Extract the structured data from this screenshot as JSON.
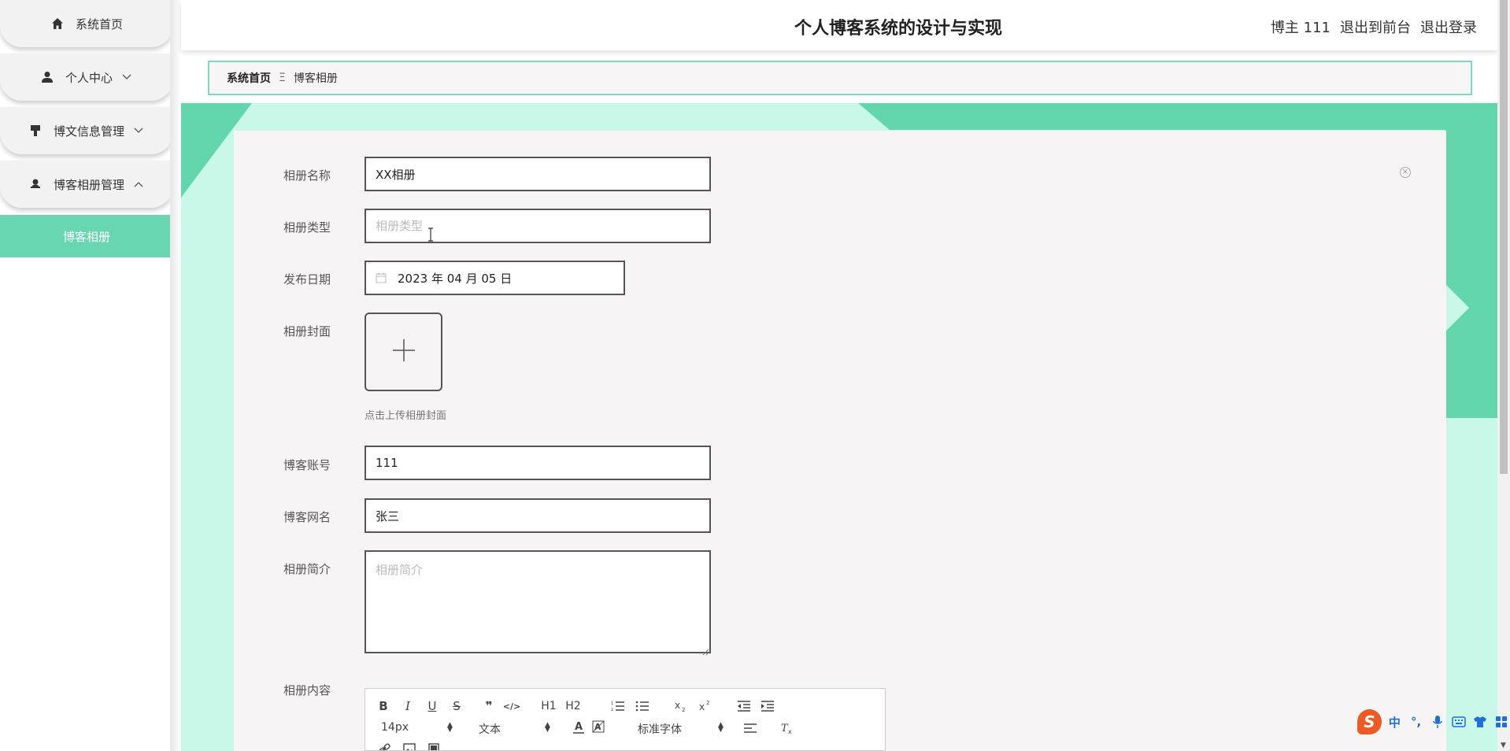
{
  "sidebar": {
    "items": [
      {
        "label": "系统首页",
        "icon": "home-icon"
      },
      {
        "label": "个人中心",
        "icon": "user-icon"
      },
      {
        "label": "博文信息管理",
        "icon": "brush-icon"
      },
      {
        "label": "博客相册管理",
        "icon": "person-icon"
      }
    ],
    "subitem": "博客相册",
    "accent": "#68d6b0"
  },
  "header": {
    "title": "个人博客系统的设计与实现",
    "user": "博主 111",
    "back_frontend": "退出到前台",
    "logout": "退出登录"
  },
  "breadcrumb": {
    "home": "系统首页",
    "separator": "Ξ",
    "current": "博客相册"
  },
  "form": {
    "album_name": {
      "label": "相册名称",
      "value": "XX相册"
    },
    "album_type": {
      "label": "相册类型",
      "placeholder": "相册类型"
    },
    "publish_date": {
      "label": "发布日期",
      "value": "2023 年 04 月 05 日"
    },
    "cover": {
      "label": "相册封面",
      "tip": "点击上传相册封面"
    },
    "account": {
      "label": "博客账号",
      "value": "111"
    },
    "nickname": {
      "label": "博客网名",
      "value": "张三"
    },
    "intro": {
      "label": "相册简介",
      "placeholder": "相册简介"
    },
    "content": {
      "label": "相册内容"
    }
  },
  "editor": {
    "toolbar_row1": [
      "B",
      "I",
      "U",
      "S",
      "❞",
      "</>",
      "H1",
      "H2",
      "ordered-list",
      "bullet-list",
      "subscript",
      "superscript",
      "outdent",
      "indent"
    ],
    "font_size": "14px",
    "header_select": "文本",
    "font_family": "标准字体"
  },
  "ime": {
    "lang": "中",
    "punct": "°,"
  }
}
